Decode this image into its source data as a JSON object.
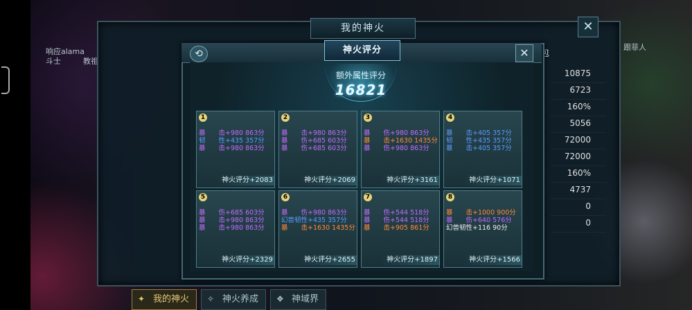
{
  "outer": {
    "title": "我的神火",
    "close_label": "✕",
    "right_stats": [
      "10875",
      "6723",
      "160%",
      "5056",
      "72000",
      "72000",
      "160%",
      "4737",
      "0",
      "0"
    ],
    "ghost_left_1": "响应alama",
    "ghost_left_2": "斗士",
    "ghost_left_3": "教祖",
    "ghost_right_1": "跟菲人",
    "ghost_right_2": "包",
    "tabs": [
      {
        "label": "我的神火",
        "icon": "fire-icon",
        "active": true
      },
      {
        "label": "神火养成",
        "icon": "upgrade-icon",
        "active": false
      },
      {
        "label": "神域界",
        "icon": "realm-icon",
        "active": false
      }
    ]
  },
  "dialog": {
    "title": "神火评分",
    "back_label": "⟲",
    "close_label": "✕",
    "extra_label": "额外属性评分",
    "extra_value": "16821",
    "cells": [
      {
        "num": "1",
        "foot": "神火评分+2083",
        "attrs": [
          {
            "text": "暴　　击+980 863分",
            "color": "purple"
          },
          {
            "text": "韧　　性+435 357分",
            "color": "blue"
          },
          {
            "text": "暴　　击+980 863分",
            "color": "purple"
          }
        ]
      },
      {
        "num": "2",
        "foot": "神火评分+2069",
        "attrs": [
          {
            "text": "暴　　击+980 863分",
            "color": "purple"
          },
          {
            "text": "暴　　伤+685 603分",
            "color": "purple"
          },
          {
            "text": "暴　　伤+685 603分",
            "color": "purple"
          }
        ]
      },
      {
        "num": "3",
        "foot": "神火评分+3161",
        "attrs": [
          {
            "text": "暴　　伤+980 863分",
            "color": "purple"
          },
          {
            "text": "暴　　击+1630 1435分",
            "color": "orange"
          },
          {
            "text": "暴　　伤+980 863分",
            "color": "purple"
          }
        ]
      },
      {
        "num": "4",
        "foot": "神火评分+1071",
        "attrs": [
          {
            "text": "暴　　击+405 357分",
            "color": "blue"
          },
          {
            "text": "韧　　性+435 357分",
            "color": "blue"
          },
          {
            "text": "暴　　击+405 357分",
            "color": "blue"
          }
        ]
      },
      {
        "num": "5",
        "foot": "神火评分+2329",
        "attrs": [
          {
            "text": "暴　　伤+685 603分",
            "color": "purple"
          },
          {
            "text": "暴　　击+980 863分",
            "color": "purple"
          },
          {
            "text": "暴　　击+980 863分",
            "color": "purple"
          }
        ]
      },
      {
        "num": "6",
        "foot": "神火评分+2655",
        "attrs": [
          {
            "text": "暴　　伤+980 863分",
            "color": "purple"
          },
          {
            "text": "幻兽韧性+435 357分",
            "color": "blue"
          },
          {
            "text": "暴　　击+1630 1435分",
            "color": "orange"
          }
        ]
      },
      {
        "num": "7",
        "foot": "神火评分+1897",
        "attrs": [
          {
            "text": "暴　　伤+544 518分",
            "color": "purple"
          },
          {
            "text": "暴　　伤+544 518分",
            "color": "purple"
          },
          {
            "text": "暴　　击+905 861分",
            "color": "orange"
          }
        ]
      },
      {
        "num": "8",
        "foot": "神火评分+1566",
        "attrs": [
          {
            "text": "暴　　击+1000 900分",
            "color": "orange"
          },
          {
            "text": "暴　　伤+640 576分",
            "color": "purple"
          },
          {
            "text": "幻兽韧性+116 90分",
            "color": "white"
          }
        ]
      }
    ]
  },
  "colors": {
    "blue": "#5a9bff",
    "purple": "#c26bff",
    "orange": "#ff8a3c",
    "white": "#f0f0f0"
  }
}
